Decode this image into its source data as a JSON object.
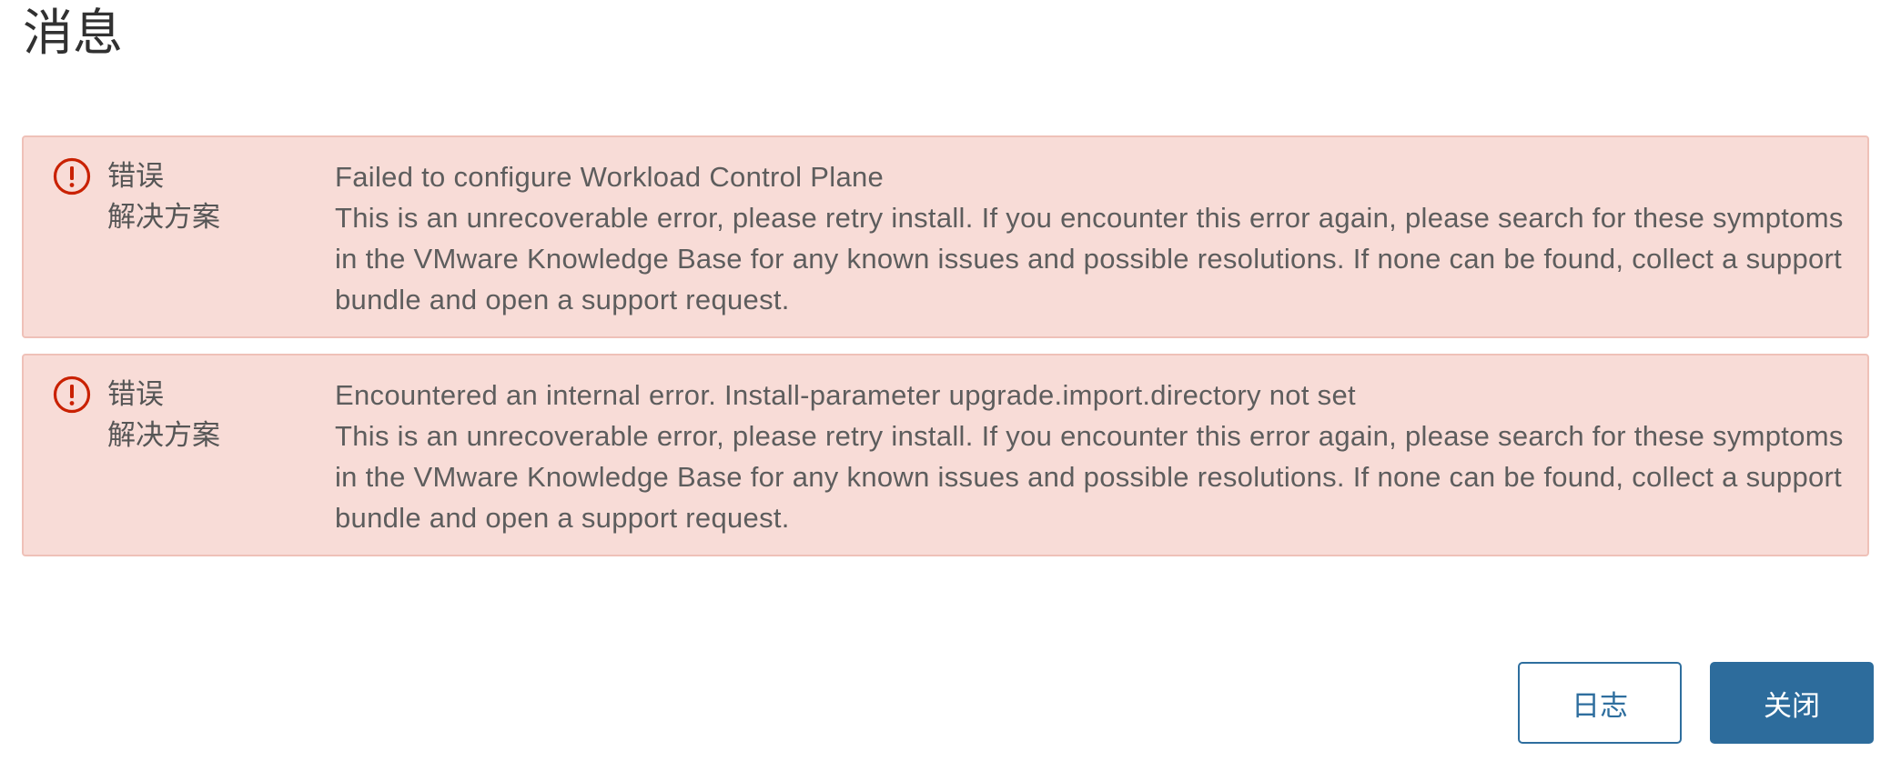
{
  "dialog": {
    "title": "消息"
  },
  "messages": [
    {
      "icon": "error-circle-icon",
      "type_label": "错误",
      "resolution_label": "解决方案",
      "message": "Failed to configure Workload Control Plane",
      "resolution": "This is an unrecoverable error, please retry install. If you encounter this error again, please search for these symptoms in the VMware Knowledge Base for any known issues and possible resolutions. If none can be found, collect a support bundle and open a support request."
    },
    {
      "icon": "error-circle-icon",
      "type_label": "错误",
      "resolution_label": "解决方案",
      "message": "Encountered an internal error. Install-parameter upgrade.import.directory not set",
      "resolution": "This is an unrecoverable error, please retry install. If you encounter this error again, please search for these symptoms in the VMware Knowledge Base for any known issues and possible resolutions. If none can be found, collect a support bundle and open a support request."
    }
  ],
  "footer": {
    "log_label": "日志",
    "close_label": "关闭"
  },
  "colors": {
    "alert_bg": "#f8dcd7",
    "alert_border": "#efc1b8",
    "error_icon": "#c92100",
    "primary": "#2d6c9c"
  }
}
